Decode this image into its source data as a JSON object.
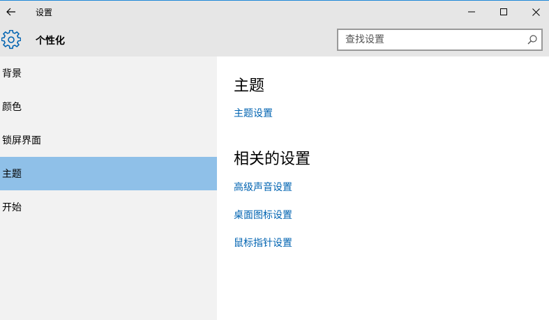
{
  "window": {
    "title": "设置"
  },
  "header": {
    "title": "个性化",
    "search_placeholder": "查找设置"
  },
  "sidebar": {
    "items": [
      {
        "label": "背景"
      },
      {
        "label": "颜色"
      },
      {
        "label": "锁屏界面"
      },
      {
        "label": "主题"
      },
      {
        "label": "开始"
      }
    ],
    "selected_index": 3
  },
  "main": {
    "section1": {
      "title": "主题",
      "links": [
        "主题设置"
      ]
    },
    "section2": {
      "title": "相关的设置",
      "links": [
        "高级声音设置",
        "桌面图标设置",
        "鼠标指针设置"
      ]
    }
  },
  "colors": {
    "accent": "#0063b1",
    "selected": "#8fc0e8",
    "titlebar": "#e6e6e6",
    "sidebar": "#f2f2f2"
  }
}
